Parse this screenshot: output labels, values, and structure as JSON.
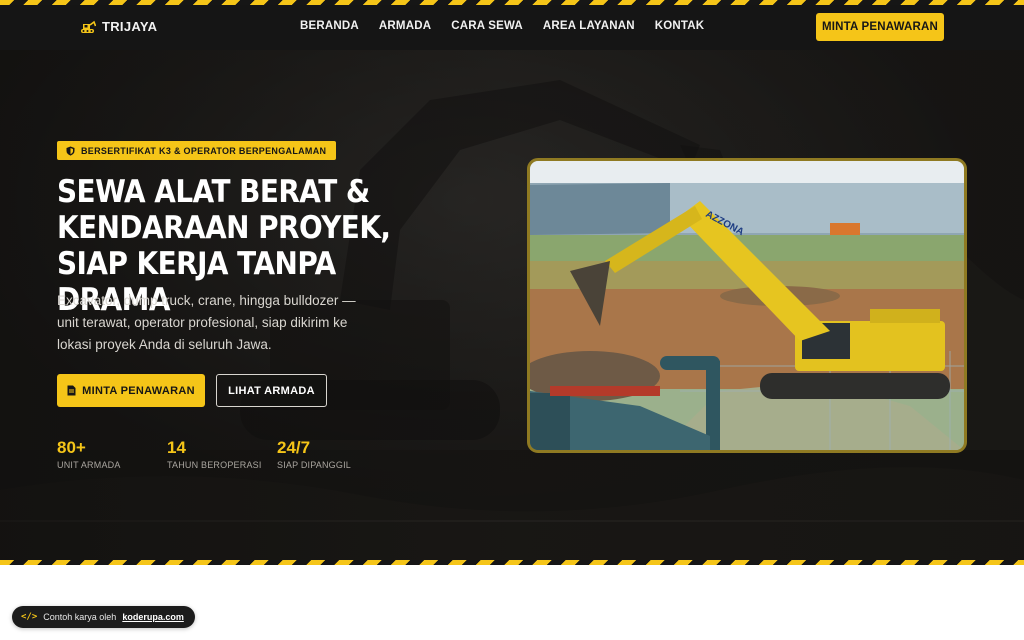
{
  "brand": {
    "name": "TRIJAYA",
    "icon": "excavator-icon"
  },
  "nav": {
    "links": [
      "BERANDA",
      "ARMADA",
      "CARA SEWA",
      "AREA LAYANAN",
      "KONTAK"
    ],
    "cta_label": "MINTA PENAWARAN"
  },
  "hero": {
    "badge": "BERSERTIFIKAT K3 & OPERATOR BERPENGALAMAN",
    "badge_icon": "shield-icon",
    "title": "SEWA ALAT BERAT & KENDARAAN PROYEK, SIAP KERJA TANPA DRAMA",
    "subtitle": "Excavator, dump truck, crane, hingga bulldozer — unit terawat, operator profesional, siap dikirim ke lokasi proyek Anda di seluruh Jawa.",
    "primary_button": "MINTA PENAWARAN",
    "primary_icon": "document-icon",
    "secondary_button": "LIHAT ARMADA",
    "stats": [
      {
        "value": "80+",
        "label": "UNIT ARMADA"
      },
      {
        "value": "14",
        "label": "TAHUN BEROPERASI"
      },
      {
        "value": "24/7",
        "label": "SIAP DIPANGGIL"
      }
    ],
    "photo_text": "AZZONA"
  },
  "credit": {
    "text": "Contoh karya oleh",
    "link": "koderupa.com",
    "icon": "code-icon"
  },
  "colors": {
    "accent": "#f5c518",
    "dark": "#151515",
    "hero_bg": "#2a2825"
  }
}
